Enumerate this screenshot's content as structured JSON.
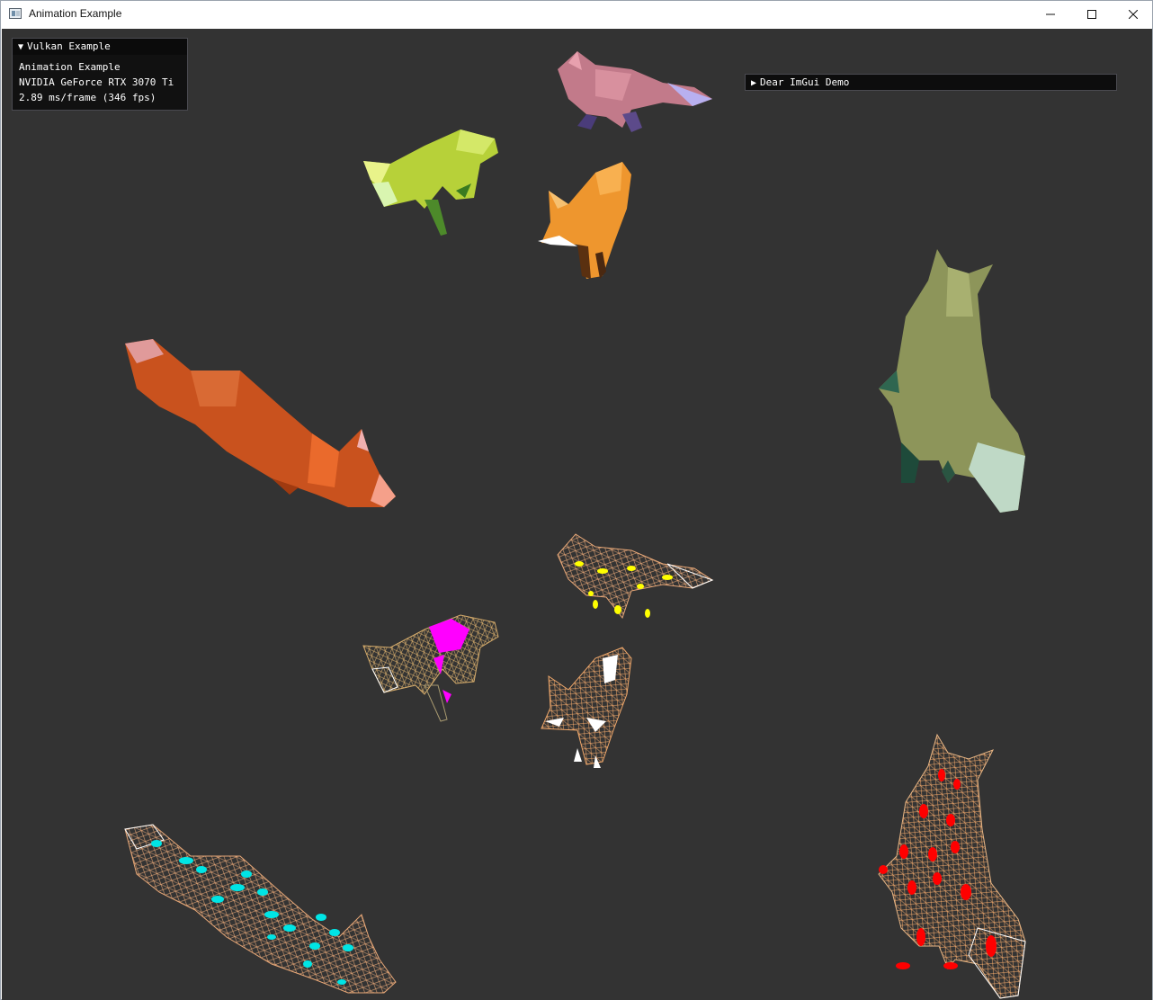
{
  "window": {
    "title": "Animation Example",
    "icon": "app-window-icon",
    "controls": {
      "minimize": "minimize-icon",
      "maximize": "maximize-icon",
      "close": "close-icon"
    }
  },
  "imgui": {
    "vulkan_panel": {
      "title": "Vulkan Example",
      "expanded": true,
      "lines": [
        "Animation Example",
        "NVIDIA GeForce RTX 3070 Ti",
        "2.89 ms/frame (346 fps)"
      ]
    },
    "demo_panel": {
      "title": "Dear ImGui Demo",
      "expanded": false
    }
  },
  "scene": {
    "background": "#333333",
    "solid_fox_colors": [
      "#c77f8f",
      "#b8d13a",
      "#f0962c",
      "#d2541f",
      "#8f955a"
    ],
    "wire_fox_colors": [
      "#e6a87a",
      "#d9b06a",
      "#e89b4f",
      "#f0a060",
      "#e8b685"
    ],
    "joint_colors": [
      "#ffff00",
      "#ff00ff",
      "#ffffff",
      "#00e5e5",
      "#ff0000"
    ]
  }
}
